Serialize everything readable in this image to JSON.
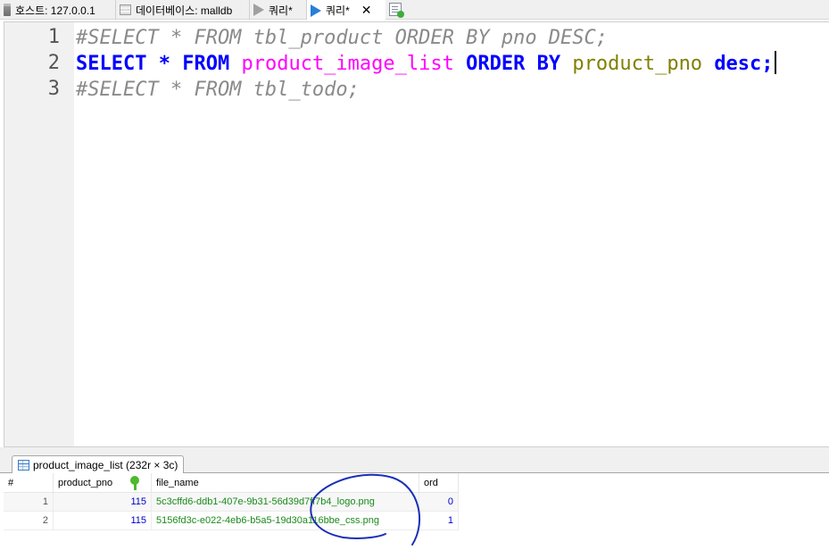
{
  "tabs": [
    {
      "label": "호스트: 127.0.0.1",
      "icon": "server-icon"
    },
    {
      "label": "데이터베이스: malldb",
      "icon": "database-icon"
    },
    {
      "label": "쿼리*",
      "icon": "query-play-icon"
    },
    {
      "label": "쿼리*",
      "icon": "query-play-icon",
      "active": true
    }
  ],
  "editor": {
    "line_numbers": [
      "1",
      "2",
      "3"
    ],
    "lines": [
      {
        "comment": "#SELECT * FROM tbl_product ORDER BY pno DESC;"
      },
      {
        "kw_select": "SELECT",
        "star": " * ",
        "kw_from": "FROM",
        "table": "product_image_list",
        "kw_order": "ORDER BY",
        "column": "product_pno",
        "kw_desc": "desc",
        "semi": ";"
      },
      {
        "comment": "#SELECT * FROM tbl_todo;"
      }
    ]
  },
  "result": {
    "tab_label": "product_image_list (232r × 3c)",
    "columns": [
      "#",
      "product_pno",
      "file_name",
      "ord"
    ],
    "rows": [
      {
        "n": "1",
        "product_pno": "115",
        "file_name": "5c3cffd6-ddb1-407e-9b31-56d39d7ff7b4_logo.png",
        "ord": "0"
      },
      {
        "n": "2",
        "product_pno": "115",
        "file_name": "5156fd3c-e022-4eb6-b5a5-19d30a116bbe_css.png",
        "ord": "1"
      }
    ]
  },
  "colors": {
    "keyword": "#0000ff",
    "table_name": "#ff00ff",
    "column_name": "#808000",
    "comment": "#8a8a8a",
    "cell_text": "#1a8a1a",
    "number_cell": "#0000cc",
    "annotation_ink": "#1a2fb8"
  }
}
